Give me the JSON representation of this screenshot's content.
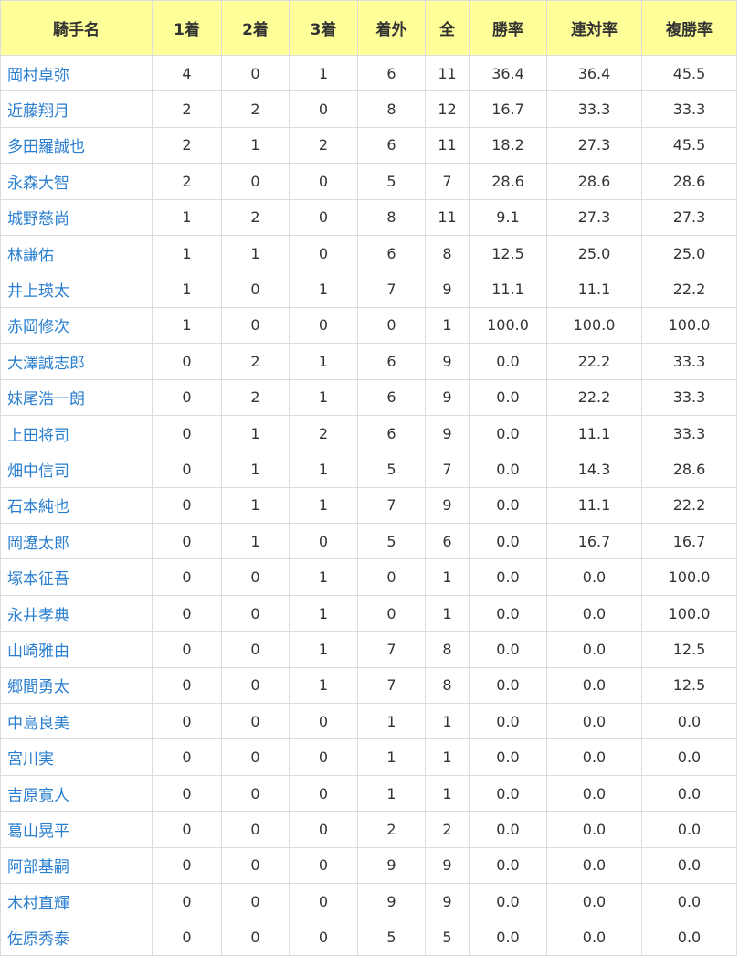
{
  "table": {
    "headers": [
      "騎手名",
      "1着",
      "2着",
      "3着",
      "着外",
      "全",
      "勝率",
      "連対率",
      "複勝率"
    ],
    "rows": [
      {
        "name": "岡村卓弥",
        "first": "4",
        "second": "0",
        "third": "1",
        "out": "6",
        "total": "11",
        "win_rate": "36.4",
        "win_color": "hi",
        "quinella_rate": "36.4",
        "quinella_color": "mid",
        "show_rate": "45.5",
        "show_color": "mid"
      },
      {
        "name": "近藤翔月",
        "first": "2",
        "second": "2",
        "third": "0",
        "out": "8",
        "total": "12",
        "win_rate": "16.7",
        "win_color": "mid",
        "quinella_rate": "33.3",
        "quinella_color": "mid",
        "show_rate": "33.3",
        "show_color": "normal"
      },
      {
        "name": "多田羅誠也",
        "first": "2",
        "second": "1",
        "third": "2",
        "out": "6",
        "total": "11",
        "win_rate": "18.2",
        "win_color": "mid",
        "quinella_rate": "27.3",
        "quinella_color": "normal",
        "show_rate": "45.5",
        "show_color": "mid"
      },
      {
        "name": "永森大智",
        "first": "2",
        "second": "0",
        "third": "0",
        "out": "5",
        "total": "7",
        "win_rate": "28.6",
        "win_color": "hi",
        "quinella_rate": "28.6",
        "quinella_color": "normal",
        "show_rate": "28.6",
        "show_color": "normal"
      },
      {
        "name": "城野慈尚",
        "first": "1",
        "second": "2",
        "third": "0",
        "out": "8",
        "total": "11",
        "win_rate": "9.1",
        "win_color": "normal",
        "quinella_rate": "27.3",
        "quinella_color": "normal",
        "show_rate": "27.3",
        "show_color": "normal"
      },
      {
        "name": "林謙佑",
        "first": "1",
        "second": "1",
        "third": "0",
        "out": "6",
        "total": "8",
        "win_rate": "12.5",
        "win_color": "normal",
        "quinella_rate": "25.0",
        "quinella_color": "normal",
        "show_rate": "25.0",
        "show_color": "normal"
      },
      {
        "name": "井上瑛太",
        "first": "1",
        "second": "0",
        "third": "1",
        "out": "7",
        "total": "9",
        "win_rate": "11.1",
        "win_color": "normal",
        "quinella_rate": "11.1",
        "quinella_color": "normal",
        "show_rate": "22.2",
        "show_color": "normal"
      },
      {
        "name": "赤岡修次",
        "first": "1",
        "second": "0",
        "third": "0",
        "out": "0",
        "total": "1",
        "win_rate": "100.0",
        "win_color": "hi",
        "quinella_rate": "100.0",
        "quinella_color": "hi",
        "show_rate": "100.0",
        "show_color": "hi"
      },
      {
        "name": "大澤誠志郎",
        "first": "0",
        "second": "2",
        "third": "1",
        "out": "6",
        "total": "9",
        "win_rate": "0.0",
        "win_color": "normal",
        "quinella_rate": "22.2",
        "quinella_color": "normal",
        "show_rate": "33.3",
        "show_color": "normal"
      },
      {
        "name": "妹尾浩一朗",
        "first": "0",
        "second": "2",
        "third": "1",
        "out": "6",
        "total": "9",
        "win_rate": "0.0",
        "win_color": "normal",
        "quinella_rate": "22.2",
        "quinella_color": "normal",
        "show_rate": "33.3",
        "show_color": "normal"
      },
      {
        "name": "上田将司",
        "first": "0",
        "second": "1",
        "third": "2",
        "out": "6",
        "total": "9",
        "win_rate": "0.0",
        "win_color": "normal",
        "quinella_rate": "11.1",
        "quinella_color": "normal",
        "show_rate": "33.3",
        "show_color": "normal"
      },
      {
        "name": "畑中信司",
        "first": "0",
        "second": "1",
        "third": "1",
        "out": "5",
        "total": "7",
        "win_rate": "0.0",
        "win_color": "normal",
        "quinella_rate": "14.3",
        "quinella_color": "normal",
        "show_rate": "28.6",
        "show_color": "normal"
      },
      {
        "name": "石本純也",
        "first": "0",
        "second": "1",
        "third": "1",
        "out": "7",
        "total": "9",
        "win_rate": "0.0",
        "win_color": "normal",
        "quinella_rate": "11.1",
        "quinella_color": "normal",
        "show_rate": "22.2",
        "show_color": "normal"
      },
      {
        "name": "岡遼太郎",
        "first": "0",
        "second": "1",
        "third": "0",
        "out": "5",
        "total": "6",
        "win_rate": "0.0",
        "win_color": "normal",
        "quinella_rate": "16.7",
        "quinella_color": "normal",
        "show_rate": "16.7",
        "show_color": "normal"
      },
      {
        "name": "塚本征吾",
        "first": "0",
        "second": "0",
        "third": "1",
        "out": "0",
        "total": "1",
        "win_rate": "0.0",
        "win_color": "normal",
        "quinella_rate": "0.0",
        "quinella_color": "normal",
        "show_rate": "100.0",
        "show_color": "hi"
      },
      {
        "name": "永井孝典",
        "first": "0",
        "second": "0",
        "third": "1",
        "out": "0",
        "total": "1",
        "win_rate": "0.0",
        "win_color": "normal",
        "quinella_rate": "0.0",
        "quinella_color": "normal",
        "show_rate": "100.0",
        "show_color": "hi"
      },
      {
        "name": "山崎雅由",
        "first": "0",
        "second": "0",
        "third": "1",
        "out": "7",
        "total": "8",
        "win_rate": "0.0",
        "win_color": "normal",
        "quinella_rate": "0.0",
        "quinella_color": "normal",
        "show_rate": "12.5",
        "show_color": "normal"
      },
      {
        "name": "郷間勇太",
        "first": "0",
        "second": "0",
        "third": "1",
        "out": "7",
        "total": "8",
        "win_rate": "0.0",
        "win_color": "normal",
        "quinella_rate": "0.0",
        "quinella_color": "normal",
        "show_rate": "12.5",
        "show_color": "normal"
      },
      {
        "name": "中島良美",
        "first": "0",
        "second": "0",
        "third": "0",
        "out": "1",
        "total": "1",
        "win_rate": "0.0",
        "win_color": "normal",
        "quinella_rate": "0.0",
        "quinella_color": "normal",
        "show_rate": "0.0",
        "show_color": "normal"
      },
      {
        "name": "宮川実",
        "first": "0",
        "second": "0",
        "third": "0",
        "out": "1",
        "total": "1",
        "win_rate": "0.0",
        "win_color": "normal",
        "quinella_rate": "0.0",
        "quinella_color": "normal",
        "show_rate": "0.0",
        "show_color": "normal"
      },
      {
        "name": "吉原寛人",
        "first": "0",
        "second": "0",
        "third": "0",
        "out": "1",
        "total": "1",
        "win_rate": "0.0",
        "win_color": "normal",
        "quinella_rate": "0.0",
        "quinella_color": "normal",
        "show_rate": "0.0",
        "show_color": "normal"
      },
      {
        "name": "葛山晃平",
        "first": "0",
        "second": "0",
        "third": "0",
        "out": "2",
        "total": "2",
        "win_rate": "0.0",
        "win_color": "normal",
        "quinella_rate": "0.0",
        "quinella_color": "normal",
        "show_rate": "0.0",
        "show_color": "normal"
      },
      {
        "name": "阿部基嗣",
        "first": "0",
        "second": "0",
        "third": "0",
        "out": "9",
        "total": "9",
        "win_rate": "0.0",
        "win_color": "normal",
        "quinella_rate": "0.0",
        "quinella_color": "normal",
        "show_rate": "0.0",
        "show_color": "normal"
      },
      {
        "name": "木村直輝",
        "first": "0",
        "second": "0",
        "third": "0",
        "out": "9",
        "total": "9",
        "win_rate": "0.0",
        "win_color": "normal",
        "quinella_rate": "0.0",
        "quinella_color": "normal",
        "show_rate": "0.0",
        "show_color": "normal"
      },
      {
        "name": "佐原秀泰",
        "first": "0",
        "second": "0",
        "third": "0",
        "out": "5",
        "total": "5",
        "win_rate": "0.0",
        "win_color": "normal",
        "quinella_rate": "0.0",
        "quinella_color": "normal",
        "show_rate": "0.0",
        "show_color": "normal"
      }
    ]
  },
  "colors": {
    "header_bg": "#ffff99",
    "link": "#2a7fd0",
    "highlight_high": "#c0135c",
    "highlight_mid": "#2a7fd0",
    "normal_text": "#333333",
    "border": "#dcdcdc"
  }
}
